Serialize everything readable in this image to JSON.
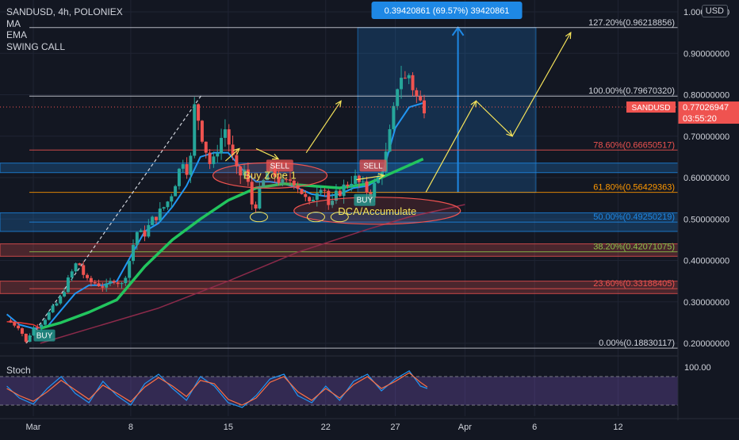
{
  "legend": {
    "symbol_line": "SANDUSD, 4h, POLONIEX",
    "indicators": [
      "MA",
      "EMA",
      "SWING CALL"
    ]
  },
  "currency_button": "USD",
  "pane_label": "Stoch",
  "colors": {
    "background": "#131722",
    "grid": "#1f2433",
    "candle_up": "#26a69a",
    "candle_down": "#ef5350",
    "ema_blue": "#2196f3",
    "ma_green": "#22c55e",
    "ma_red": "#e53935",
    "fib_box": "#1e88e5",
    "annotation_yellow": "#f5e35a",
    "zone_red": "#ef5350",
    "zone_blue": "#1e88e5"
  },
  "chart_data": {
    "type": "candlestick",
    "symbol": "SANDUSD",
    "interval": "4h",
    "exchange": "POLONIEX",
    "ylim": [
      0.18,
      1.0
    ],
    "y_ticks": [
      1.0,
      0.9,
      0.8,
      0.7,
      0.6,
      0.5,
      0.4,
      0.3,
      0.2
    ],
    "y_tick_labels": [
      "1.00000000",
      "0.90000000",
      "0.80000000",
      "0.70000000",
      "0.60000000",
      "0.50000000",
      "0.40000000",
      "0.30000000",
      "0.20000000"
    ],
    "x_ticks": [
      {
        "label": "Mar",
        "day": 1
      },
      {
        "label": "8",
        "day": 8
      },
      {
        "label": "15",
        "day": 15
      },
      {
        "label": "22",
        "day": 22
      },
      {
        "label": "27",
        "day": 27
      },
      {
        "label": "Apr",
        "day": 32
      },
      {
        "label": "6",
        "day": 37
      },
      {
        "label": "12",
        "day": 43
      }
    ],
    "last_price": {
      "symbol": "SANDUSD",
      "value": 0.77026947,
      "label": "0.77026947",
      "countdown": "03:55:20"
    },
    "price_path": [
      [
        -0.9,
        0.255
      ],
      [
        0.0,
        0.24
      ],
      [
        0.5,
        0.2
      ],
      [
        0.9,
        0.235
      ],
      [
        1.6,
        0.25
      ],
      [
        2.3,
        0.28
      ],
      [
        2.9,
        0.305
      ],
      [
        3.6,
        0.36
      ],
      [
        4.2,
        0.4
      ],
      [
        4.8,
        0.35
      ],
      [
        5.5,
        0.345
      ],
      [
        6.2,
        0.335
      ],
      [
        6.8,
        0.355
      ],
      [
        7.4,
        0.34
      ],
      [
        7.9,
        0.4
      ],
      [
        8.4,
        0.47
      ],
      [
        8.9,
        0.46
      ],
      [
        9.6,
        0.5
      ],
      [
        10.2,
        0.52
      ],
      [
        10.8,
        0.55
      ],
      [
        11.3,
        0.6
      ],
      [
        11.8,
        0.65
      ],
      [
        12.2,
        0.6
      ],
      [
        12.6,
        0.78
      ],
      [
        13.2,
        0.69
      ],
      [
        13.8,
        0.62
      ],
      [
        14.3,
        0.68
      ],
      [
        14.8,
        0.72
      ],
      [
        15.2,
        0.66
      ],
      [
        15.7,
        0.6
      ],
      [
        16.2,
        0.62
      ],
      [
        16.8,
        0.52
      ],
      [
        17.3,
        0.57
      ],
      [
        17.9,
        0.62
      ],
      [
        18.5,
        0.6
      ],
      [
        19.0,
        0.58
      ],
      [
        19.6,
        0.6
      ],
      [
        20.2,
        0.57
      ],
      [
        20.8,
        0.53
      ],
      [
        21.3,
        0.57
      ],
      [
        21.8,
        0.59
      ],
      [
        22.3,
        0.52
      ],
      [
        22.8,
        0.56
      ],
      [
        23.4,
        0.58
      ],
      [
        24.0,
        0.6
      ],
      [
        24.6,
        0.58
      ],
      [
        25.2,
        0.56
      ],
      [
        25.8,
        0.6
      ],
      [
        26.3,
        0.65
      ],
      [
        26.8,
        0.74
      ],
      [
        27.3,
        0.86
      ],
      [
        27.6,
        0.83
      ],
      [
        28.0,
        0.85
      ],
      [
        28.4,
        0.8
      ],
      [
        28.8,
        0.78
      ],
      [
        29.3,
        0.77
      ]
    ],
    "series": [
      {
        "name": "EMA",
        "color": "#2196f3",
        "points": [
          [
            -0.9,
            0.27
          ],
          [
            0.0,
            0.245
          ],
          [
            1.0,
            0.236
          ],
          [
            2.0,
            0.24
          ],
          [
            3.0,
            0.28
          ],
          [
            4.0,
            0.32
          ],
          [
            5.0,
            0.34
          ],
          [
            6.0,
            0.34
          ],
          [
            7.0,
            0.35
          ],
          [
            8.0,
            0.41
          ],
          [
            9.0,
            0.47
          ],
          [
            10.0,
            0.49
          ],
          [
            11.0,
            0.53
          ],
          [
            12.0,
            0.58
          ],
          [
            13.0,
            0.65
          ],
          [
            14.0,
            0.66
          ],
          [
            15.0,
            0.66
          ],
          [
            16.0,
            0.62
          ],
          [
            17.0,
            0.59
          ],
          [
            18.0,
            0.59
          ],
          [
            19.0,
            0.585
          ],
          [
            20.0,
            0.575
          ],
          [
            21.0,
            0.56
          ],
          [
            22.0,
            0.555
          ],
          [
            23.0,
            0.56
          ],
          [
            24.0,
            0.575
          ],
          [
            25.0,
            0.58
          ],
          [
            26.0,
            0.6
          ],
          [
            27.0,
            0.72
          ],
          [
            28.0,
            0.77
          ],
          [
            29.0,
            0.78
          ]
        ]
      },
      {
        "name": "MA",
        "color": "#22c55e",
        "points": [
          [
            1.5,
            0.236
          ],
          [
            3.0,
            0.25
          ],
          [
            5.0,
            0.275
          ],
          [
            7.0,
            0.305
          ],
          [
            9.0,
            0.385
          ],
          [
            11.0,
            0.45
          ],
          [
            13.0,
            0.5
          ],
          [
            15.0,
            0.545
          ],
          [
            17.0,
            0.575
          ],
          [
            19.0,
            0.585
          ],
          [
            21.0,
            0.58
          ],
          [
            23.0,
            0.575
          ],
          [
            25.0,
            0.585
          ],
          [
            27.0,
            0.615
          ],
          [
            29.0,
            0.645
          ]
        ]
      },
      {
        "name": "MA",
        "color": "#e53935",
        "points": [
          [
            -0.9,
            0.252
          ],
          [
            0.0,
            0.25
          ],
          [
            1.0,
            0.245
          ],
          [
            1.5,
            0.236
          ]
        ]
      },
      {
        "name": "MA",
        "color": "#8b2a4a",
        "points": [
          [
            1.5,
            0.2
          ],
          [
            5.0,
            0.235
          ],
          [
            10.0,
            0.285
          ],
          [
            15.0,
            0.35
          ],
          [
            20.0,
            0.42
          ],
          [
            25.0,
            0.475
          ],
          [
            28.0,
            0.505
          ],
          [
            32.0,
            0.535
          ]
        ]
      }
    ],
    "fibonacci": [
      {
        "label": "127.20%(0.96218856)",
        "value": 0.96218856,
        "color": "#d1d4dc"
      },
      {
        "label": "100.00%(0.79670320)",
        "value": 0.7967032,
        "color": "#d1d4dc"
      },
      {
        "label": "78.60%(0.66650517)",
        "value": 0.66650517,
        "color": "#ef5350"
      },
      {
        "label": "61.80%(0.56429363)",
        "value": 0.56429363,
        "color": "#ff9800"
      },
      {
        "label": "50.00%(0.49250219)",
        "value": 0.49250219,
        "color": "#1e88e5"
      },
      {
        "label": "38.20%(0.42071075)",
        "value": 0.42071075,
        "color": "#8bc34a"
      },
      {
        "label": "23.60%(0.33188405)",
        "value": 0.33188405,
        "color": "#ef5350"
      },
      {
        "label": "0.00%(0.18830117)",
        "value": 0.18830117,
        "color": "#d1d4dc"
      }
    ],
    "zones": [
      {
        "top": 0.635,
        "bottom": 0.612,
        "color": "#1e88e5"
      },
      {
        "top": 0.515,
        "bottom": 0.47,
        "color": "#1e88e5"
      },
      {
        "top": 0.44,
        "bottom": 0.41,
        "color": "#ef5350"
      },
      {
        "top": 0.35,
        "bottom": 0.32,
        "color": "#ef5350"
      }
    ],
    "measure": {
      "label": "0.39420861 (69.57%) 39420861",
      "from": 0.56429363,
      "to": 0.96218856
    },
    "annotations": [
      {
        "text": "Buy Zone 1",
        "day": 18.0,
        "value": 0.605
      },
      {
        "text": "DCA/Accumulate",
        "day": 25.7,
        "value": 0.52
      }
    ],
    "signals": [
      {
        "text": "BUY",
        "day": 1.8,
        "value": 0.218,
        "color": "#26a69a"
      },
      {
        "text": "SELL",
        "day": 18.7,
        "value": 0.628,
        "color": "#ef5350"
      },
      {
        "text": "SELL",
        "day": 25.4,
        "value": 0.628,
        "color": "#ef5350"
      },
      {
        "text": "BUY",
        "day": 24.8,
        "value": 0.545,
        "color": "#26a69a"
      }
    ],
    "stoch": {
      "ylim": [
        0,
        120
      ],
      "y_ticks": [
        100
      ],
      "y_tick_labels": [
        "100.00"
      ],
      "band": [
        20,
        80
      ],
      "k": [
        [
          -0.9,
          60
        ],
        [
          0.0,
          35
        ],
        [
          1.0,
          22
        ],
        [
          2.0,
          55
        ],
        [
          3.0,
          80
        ],
        [
          4.0,
          45
        ],
        [
          5.0,
          25
        ],
        [
          6.0,
          70
        ],
        [
          7.0,
          40
        ],
        [
          8.0,
          20
        ],
        [
          9.0,
          65
        ],
        [
          10.0,
          85
        ],
        [
          11.0,
          55
        ],
        [
          12.0,
          30
        ],
        [
          13.0,
          80
        ],
        [
          14.0,
          60
        ],
        [
          15.0,
          25
        ],
        [
          16.0,
          15
        ],
        [
          17.0,
          40
        ],
        [
          18.0,
          75
        ],
        [
          19.0,
          85
        ],
        [
          20.0,
          40
        ],
        [
          21.0,
          25
        ],
        [
          22.0,
          60
        ],
        [
          23.0,
          30
        ],
        [
          24.0,
          70
        ],
        [
          25.0,
          85
        ],
        [
          26.0,
          50
        ],
        [
          27.0,
          75
        ],
        [
          28.0,
          92
        ],
        [
          28.8,
          60
        ],
        [
          29.3,
          55
        ]
      ],
      "d": [
        [
          -0.9,
          55
        ],
        [
          0.0,
          40
        ],
        [
          1.0,
          28
        ],
        [
          2.0,
          48
        ],
        [
          3.0,
          72
        ],
        [
          4.0,
          52
        ],
        [
          5.0,
          32
        ],
        [
          6.0,
          62
        ],
        [
          7.0,
          45
        ],
        [
          8.0,
          27
        ],
        [
          9.0,
          58
        ],
        [
          10.0,
          78
        ],
        [
          11.0,
          60
        ],
        [
          12.0,
          38
        ],
        [
          13.0,
          72
        ],
        [
          14.0,
          65
        ],
        [
          15.0,
          32
        ],
        [
          16.0,
          20
        ],
        [
          17.0,
          35
        ],
        [
          18.0,
          68
        ],
        [
          19.0,
          80
        ],
        [
          20.0,
          48
        ],
        [
          21.0,
          30
        ],
        [
          22.0,
          55
        ],
        [
          23.0,
          35
        ],
        [
          24.0,
          63
        ],
        [
          25.0,
          80
        ],
        [
          26.0,
          55
        ],
        [
          27.0,
          70
        ],
        [
          28.0,
          88
        ],
        [
          28.8,
          68
        ],
        [
          29.3,
          58
        ]
      ]
    }
  }
}
